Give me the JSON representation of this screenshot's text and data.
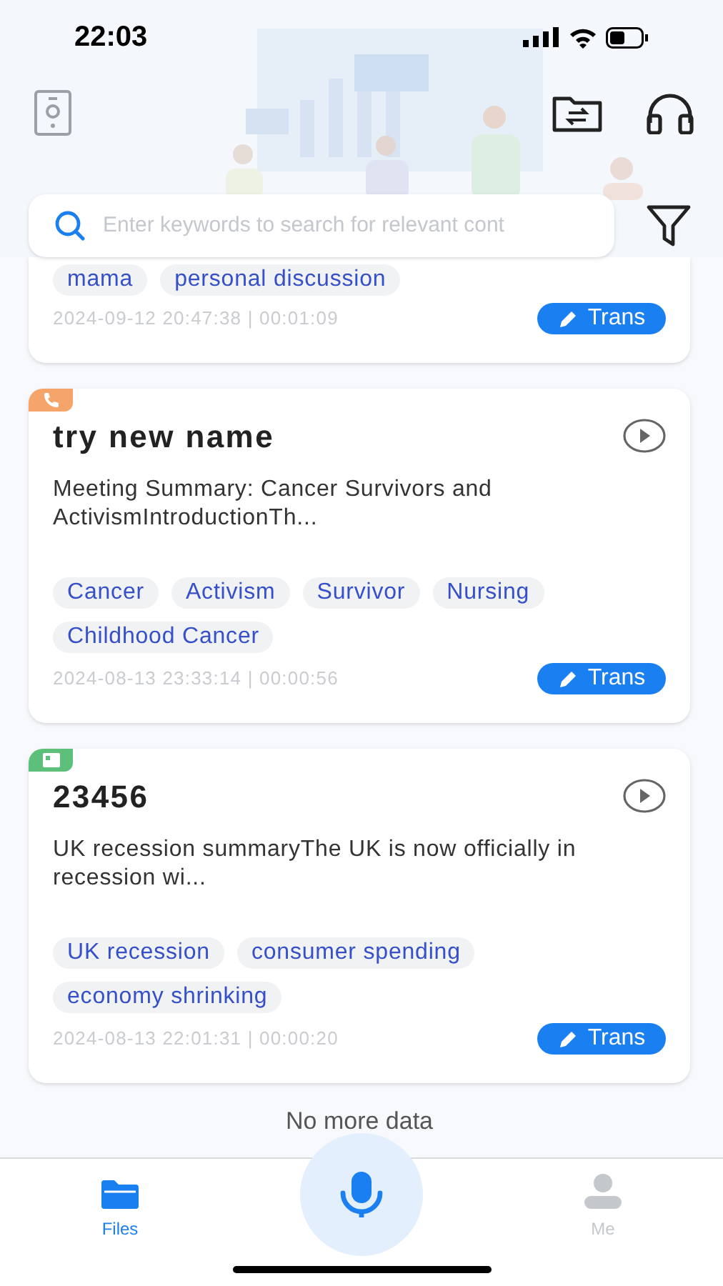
{
  "status_bar": {
    "time": "22:03"
  },
  "search": {
    "placeholder": "Enter keywords to search for relevant cont"
  },
  "partial_record": {
    "tags": [
      "mama",
      "personal discussion"
    ],
    "datetime": "2024-09-12 20:47:38 | 00:01:09",
    "action": "Trans"
  },
  "records": [
    {
      "kind": "call",
      "title": "try new name",
      "summary": "Meeting Summary: Cancer Survivors and ActivismIntroductionTh...",
      "tags": [
        "Cancer",
        "Activism",
        "Survivor",
        "Nursing",
        "Childhood Cancer"
      ],
      "datetime": "2024-08-13 23:33:14 | 00:00:56",
      "action": "Trans"
    },
    {
      "kind": "file",
      "title": "23456",
      "summary": "UK recession summaryThe UK is now officially in recession wi...",
      "tags": [
        "UK recession",
        "consumer spending",
        "economy shrinking"
      ],
      "datetime": "2024-08-13 22:01:31 | 00:00:20",
      "action": "Trans"
    }
  ],
  "footer_note": "No more data",
  "tab_bar": {
    "tabs": [
      {
        "label": "Files",
        "selected": true
      },
      {
        "label": "Me",
        "selected": false
      }
    ]
  }
}
